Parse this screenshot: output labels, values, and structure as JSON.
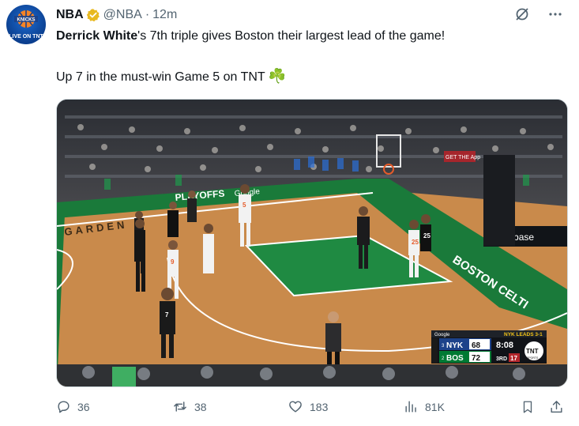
{
  "author": {
    "name": "NBA",
    "handle": "@NBA",
    "separator": "·",
    "time": "12m",
    "avatar_text": "LIVE ON TNT"
  },
  "tweet": {
    "bold_name": "Derrick White",
    "line1_rest": "'s 7th triple gives Boston their largest lead of the game!",
    "line2": "Up 7 in the must-win Game 5 on TNT",
    "emoji": "☘️"
  },
  "media": {
    "playoffs_board": "PLAYOFFS",
    "board_brand": "Google",
    "garden": "GARDEN",
    "boston_celtics": "BOSTON CELTI",
    "coinbase": "coinbase",
    "rows_text": "GET THE App",
    "scorebug": {
      "brand": "Google",
      "series": "NYK LEADS 3-1",
      "team1": {
        "seed": "3",
        "abbr": "NYK",
        "score": "68"
      },
      "team2": {
        "seed": "2",
        "abbr": "BOS",
        "score": "72"
      },
      "clock": "8:08",
      "quarter": "3RD",
      "shot_clock": "17",
      "network": "TNT",
      "network_sub": "SPORTS"
    },
    "jersey_numbers": [
      "9",
      "25",
      "5",
      "7",
      "25"
    ]
  },
  "actions": {
    "replies": "36",
    "reposts": "38",
    "likes": "183",
    "views": "81K"
  },
  "colors": {
    "verified": "#e8b920",
    "court_green": "#1a7a3a",
    "court_wood": "#c98a4b",
    "text_secondary": "#536471"
  },
  "icons": [
    "verified-badge-icon",
    "grok-icon",
    "more-icon",
    "reply-icon",
    "repost-icon",
    "like-icon",
    "views-icon",
    "bookmark-icon",
    "share-icon",
    "clover-emoji"
  ]
}
